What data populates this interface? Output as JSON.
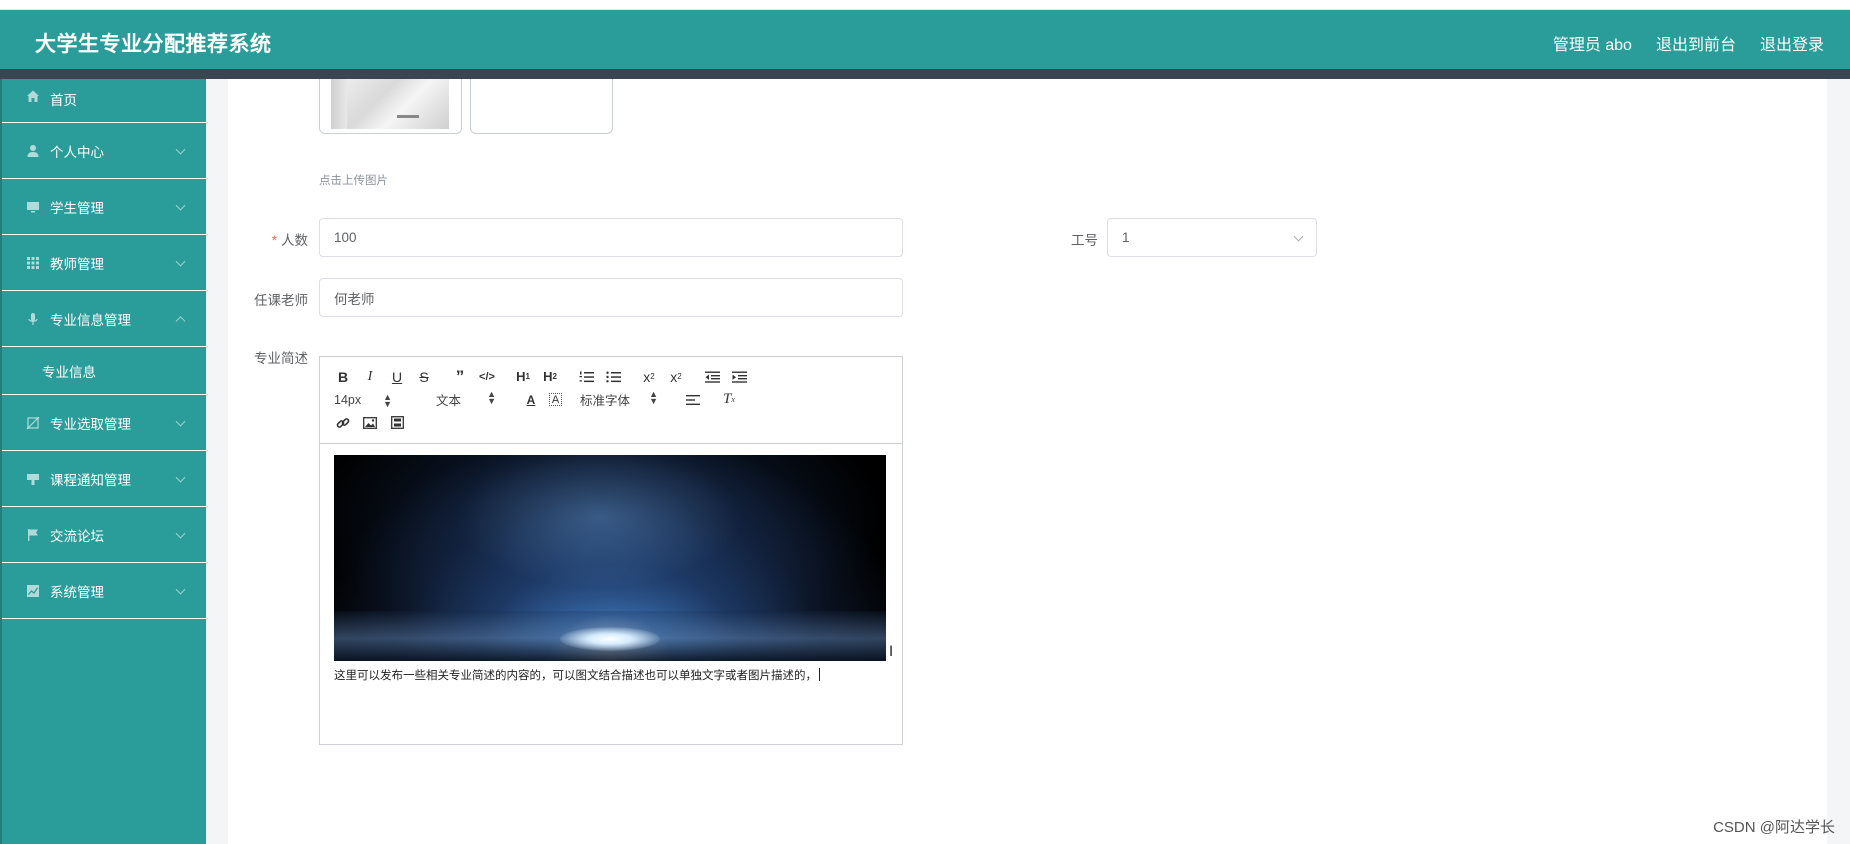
{
  "header": {
    "title": "大学生专业分配推荐系统",
    "user": "管理员 abo",
    "to_front": "退出到前台",
    "logout": "退出登录"
  },
  "sidebar": {
    "items": [
      {
        "label": "首页",
        "icon": "home-icon"
      },
      {
        "label": "个人中心",
        "icon": "user-icon"
      },
      {
        "label": "学生管理",
        "icon": "monitor-icon"
      },
      {
        "label": "教师管理",
        "icon": "grid-icon"
      },
      {
        "label": "专业信息管理",
        "icon": "microphone-icon",
        "expanded": true,
        "children": [
          "专业信息"
        ]
      },
      {
        "label": "专业选取管理",
        "icon": "edit-off-icon"
      },
      {
        "label": "课程通知管理",
        "icon": "stamp-icon"
      },
      {
        "label": "交流论坛",
        "icon": "flag-icon"
      },
      {
        "label": "系统管理",
        "icon": "chart-icon"
      }
    ]
  },
  "form": {
    "upload_hint": "点击上传图片",
    "people_label": "人数",
    "people_value": "100",
    "job_no_label": "工号",
    "job_no_value": "1",
    "teacher_label": "任课老师",
    "teacher_value": "何老师",
    "desc_label": "专业简述"
  },
  "editor": {
    "font_size": "14px",
    "paragraph": "文本",
    "font_family": "标准字体",
    "text": "这里可以发布一些相关专业简述的内容的，可以图文结合描述也可以单独文字或者图片描述的，"
  },
  "watermark": "CSDN @阿达学长"
}
